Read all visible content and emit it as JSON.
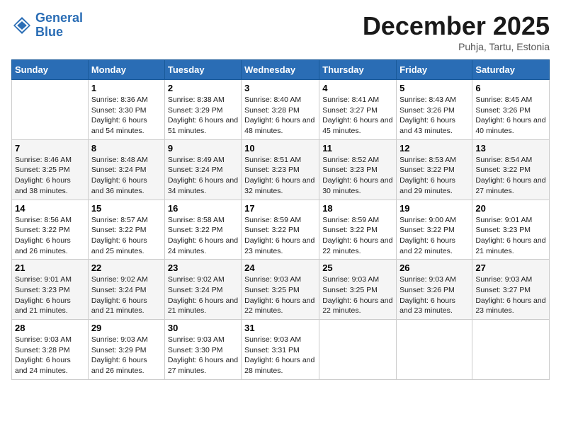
{
  "header": {
    "logo_general": "General",
    "logo_blue": "Blue",
    "month": "December 2025",
    "location": "Puhja, Tartu, Estonia"
  },
  "days_of_week": [
    "Sunday",
    "Monday",
    "Tuesday",
    "Wednesday",
    "Thursday",
    "Friday",
    "Saturday"
  ],
  "weeks": [
    [
      {
        "num": "",
        "sunrise": "",
        "sunset": "",
        "daylight": ""
      },
      {
        "num": "1",
        "sunrise": "Sunrise: 8:36 AM",
        "sunset": "Sunset: 3:30 PM",
        "daylight": "Daylight: 6 hours and 54 minutes."
      },
      {
        "num": "2",
        "sunrise": "Sunrise: 8:38 AM",
        "sunset": "Sunset: 3:29 PM",
        "daylight": "Daylight: 6 hours and 51 minutes."
      },
      {
        "num": "3",
        "sunrise": "Sunrise: 8:40 AM",
        "sunset": "Sunset: 3:28 PM",
        "daylight": "Daylight: 6 hours and 48 minutes."
      },
      {
        "num": "4",
        "sunrise": "Sunrise: 8:41 AM",
        "sunset": "Sunset: 3:27 PM",
        "daylight": "Daylight: 6 hours and 45 minutes."
      },
      {
        "num": "5",
        "sunrise": "Sunrise: 8:43 AM",
        "sunset": "Sunset: 3:26 PM",
        "daylight": "Daylight: 6 hours and 43 minutes."
      },
      {
        "num": "6",
        "sunrise": "Sunrise: 8:45 AM",
        "sunset": "Sunset: 3:26 PM",
        "daylight": "Daylight: 6 hours and 40 minutes."
      }
    ],
    [
      {
        "num": "7",
        "sunrise": "Sunrise: 8:46 AM",
        "sunset": "Sunset: 3:25 PM",
        "daylight": "Daylight: 6 hours and 38 minutes."
      },
      {
        "num": "8",
        "sunrise": "Sunrise: 8:48 AM",
        "sunset": "Sunset: 3:24 PM",
        "daylight": "Daylight: 6 hours and 36 minutes."
      },
      {
        "num": "9",
        "sunrise": "Sunrise: 8:49 AM",
        "sunset": "Sunset: 3:24 PM",
        "daylight": "Daylight: 6 hours and 34 minutes."
      },
      {
        "num": "10",
        "sunrise": "Sunrise: 8:51 AM",
        "sunset": "Sunset: 3:23 PM",
        "daylight": "Daylight: 6 hours and 32 minutes."
      },
      {
        "num": "11",
        "sunrise": "Sunrise: 8:52 AM",
        "sunset": "Sunset: 3:23 PM",
        "daylight": "Daylight: 6 hours and 30 minutes."
      },
      {
        "num": "12",
        "sunrise": "Sunrise: 8:53 AM",
        "sunset": "Sunset: 3:22 PM",
        "daylight": "Daylight: 6 hours and 29 minutes."
      },
      {
        "num": "13",
        "sunrise": "Sunrise: 8:54 AM",
        "sunset": "Sunset: 3:22 PM",
        "daylight": "Daylight: 6 hours and 27 minutes."
      }
    ],
    [
      {
        "num": "14",
        "sunrise": "Sunrise: 8:56 AM",
        "sunset": "Sunset: 3:22 PM",
        "daylight": "Daylight: 6 hours and 26 minutes."
      },
      {
        "num": "15",
        "sunrise": "Sunrise: 8:57 AM",
        "sunset": "Sunset: 3:22 PM",
        "daylight": "Daylight: 6 hours and 25 minutes."
      },
      {
        "num": "16",
        "sunrise": "Sunrise: 8:58 AM",
        "sunset": "Sunset: 3:22 PM",
        "daylight": "Daylight: 6 hours and 24 minutes."
      },
      {
        "num": "17",
        "sunrise": "Sunrise: 8:59 AM",
        "sunset": "Sunset: 3:22 PM",
        "daylight": "Daylight: 6 hours and 23 minutes."
      },
      {
        "num": "18",
        "sunrise": "Sunrise: 8:59 AM",
        "sunset": "Sunset: 3:22 PM",
        "daylight": "Daylight: 6 hours and 22 minutes."
      },
      {
        "num": "19",
        "sunrise": "Sunrise: 9:00 AM",
        "sunset": "Sunset: 3:22 PM",
        "daylight": "Daylight: 6 hours and 22 minutes."
      },
      {
        "num": "20",
        "sunrise": "Sunrise: 9:01 AM",
        "sunset": "Sunset: 3:23 PM",
        "daylight": "Daylight: 6 hours and 21 minutes."
      }
    ],
    [
      {
        "num": "21",
        "sunrise": "Sunrise: 9:01 AM",
        "sunset": "Sunset: 3:23 PM",
        "daylight": "Daylight: 6 hours and 21 minutes."
      },
      {
        "num": "22",
        "sunrise": "Sunrise: 9:02 AM",
        "sunset": "Sunset: 3:24 PM",
        "daylight": "Daylight: 6 hours and 21 minutes."
      },
      {
        "num": "23",
        "sunrise": "Sunrise: 9:02 AM",
        "sunset": "Sunset: 3:24 PM",
        "daylight": "Daylight: 6 hours and 21 minutes."
      },
      {
        "num": "24",
        "sunrise": "Sunrise: 9:03 AM",
        "sunset": "Sunset: 3:25 PM",
        "daylight": "Daylight: 6 hours and 22 minutes."
      },
      {
        "num": "25",
        "sunrise": "Sunrise: 9:03 AM",
        "sunset": "Sunset: 3:25 PM",
        "daylight": "Daylight: 6 hours and 22 minutes."
      },
      {
        "num": "26",
        "sunrise": "Sunrise: 9:03 AM",
        "sunset": "Sunset: 3:26 PM",
        "daylight": "Daylight: 6 hours and 23 minutes."
      },
      {
        "num": "27",
        "sunrise": "Sunrise: 9:03 AM",
        "sunset": "Sunset: 3:27 PM",
        "daylight": "Daylight: 6 hours and 23 minutes."
      }
    ],
    [
      {
        "num": "28",
        "sunrise": "Sunrise: 9:03 AM",
        "sunset": "Sunset: 3:28 PM",
        "daylight": "Daylight: 6 hours and 24 minutes."
      },
      {
        "num": "29",
        "sunrise": "Sunrise: 9:03 AM",
        "sunset": "Sunset: 3:29 PM",
        "daylight": "Daylight: 6 hours and 26 minutes."
      },
      {
        "num": "30",
        "sunrise": "Sunrise: 9:03 AM",
        "sunset": "Sunset: 3:30 PM",
        "daylight": "Daylight: 6 hours and 27 minutes."
      },
      {
        "num": "31",
        "sunrise": "Sunrise: 9:03 AM",
        "sunset": "Sunset: 3:31 PM",
        "daylight": "Daylight: 6 hours and 28 minutes."
      },
      {
        "num": "",
        "sunrise": "",
        "sunset": "",
        "daylight": ""
      },
      {
        "num": "",
        "sunrise": "",
        "sunset": "",
        "daylight": ""
      },
      {
        "num": "",
        "sunrise": "",
        "sunset": "",
        "daylight": ""
      }
    ]
  ]
}
